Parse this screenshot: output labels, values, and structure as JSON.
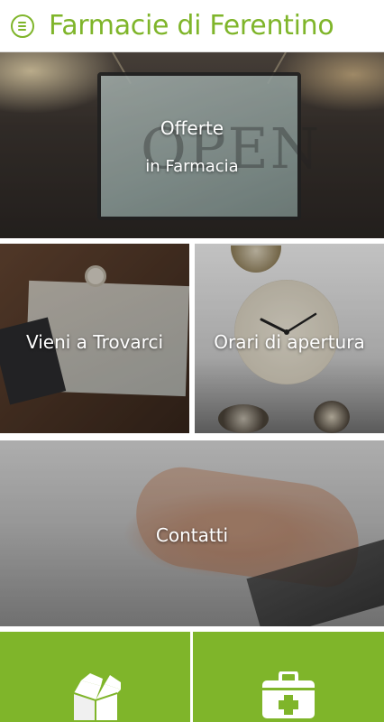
{
  "header": {
    "title": "Farmacie di Ferentino",
    "menu_icon": "menu-circle-icon"
  },
  "tiles": {
    "offerte": {
      "line1": "Offerte",
      "line2": "in Farmacia"
    },
    "vieni": {
      "label": "Vieni a Trovarci"
    },
    "orari": {
      "label": "Orari di apertura"
    },
    "contatti": {
      "label": "Contatti"
    }
  },
  "bottom_buttons": [
    {
      "icon": "open-box-icon"
    },
    {
      "icon": "first-aid-kit-icon"
    }
  ],
  "colors": {
    "accent": "#7fb52a",
    "background": "#ffffff"
  }
}
